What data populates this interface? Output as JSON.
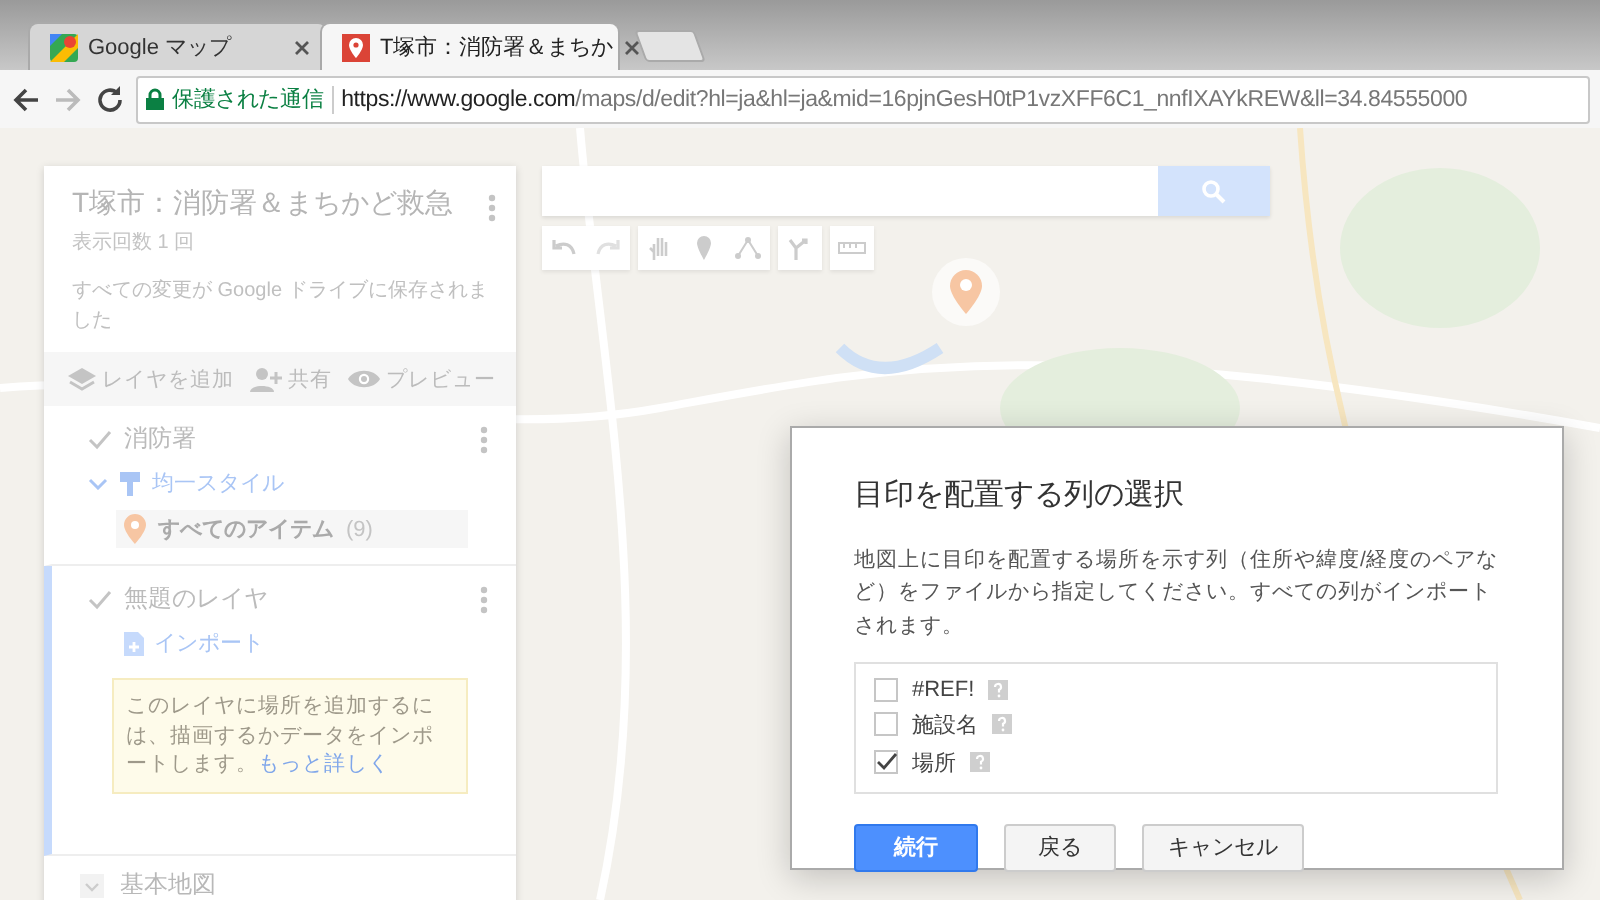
{
  "browser": {
    "tabs": [
      {
        "label": "Google マップ",
        "selected": false,
        "kind": "maps"
      },
      {
        "label": "T塚市：消防署＆まちか",
        "selected": true,
        "kind": "pin"
      }
    ],
    "secure_label": "保護された通信",
    "url_host": "https://www.google.com",
    "url_path": "/maps/d/edit?hl=ja&hl=ja&mid=16pjnGesH0tP1vzXFF6C1_nnfIXAYkREW&ll=34.84555000"
  },
  "sidebar": {
    "title": "T塚市：消防署＆まちかど救急",
    "views": "表示回数 1 回",
    "save_status": "すべての変更が Google ドライブに保存されました",
    "actions": [
      {
        "kind": "add-layer",
        "label": "レイヤを追加"
      },
      {
        "kind": "share",
        "label": "共有"
      },
      {
        "kind": "preview",
        "label": "プレビュー"
      }
    ],
    "layers": [
      {
        "kind": "styled",
        "name": "消防署",
        "checked": true,
        "selected": false,
        "style": "均一スタイル",
        "items_label": "すべてのアイテム",
        "items_count": "(9)"
      },
      {
        "kind": "empty",
        "name": "無題のレイヤ",
        "checked": true,
        "selected": true,
        "import": "インポート",
        "hint": "このレイヤに場所を追加するには、描画するかデータをインポートします。",
        "hint_link": "もっと詳しく"
      }
    ],
    "base_map": "基本地図"
  },
  "dialog": {
    "title": "目印を配置する列の選択",
    "description": "地図上に目印を配置する場所を示す列（住所や緯度/経度のペアなど）をファイルから指定してください。すべての列がインポートされます。",
    "columns": [
      {
        "label": "#REF!",
        "checked": false
      },
      {
        "label": "施設名",
        "checked": false
      },
      {
        "label": "場所",
        "checked": true
      }
    ],
    "buttons": [
      {
        "label": "続行",
        "kind": "primary"
      },
      {
        "label": "戻る",
        "kind": "default"
      },
      {
        "label": "キャンセル",
        "kind": "default"
      }
    ]
  }
}
